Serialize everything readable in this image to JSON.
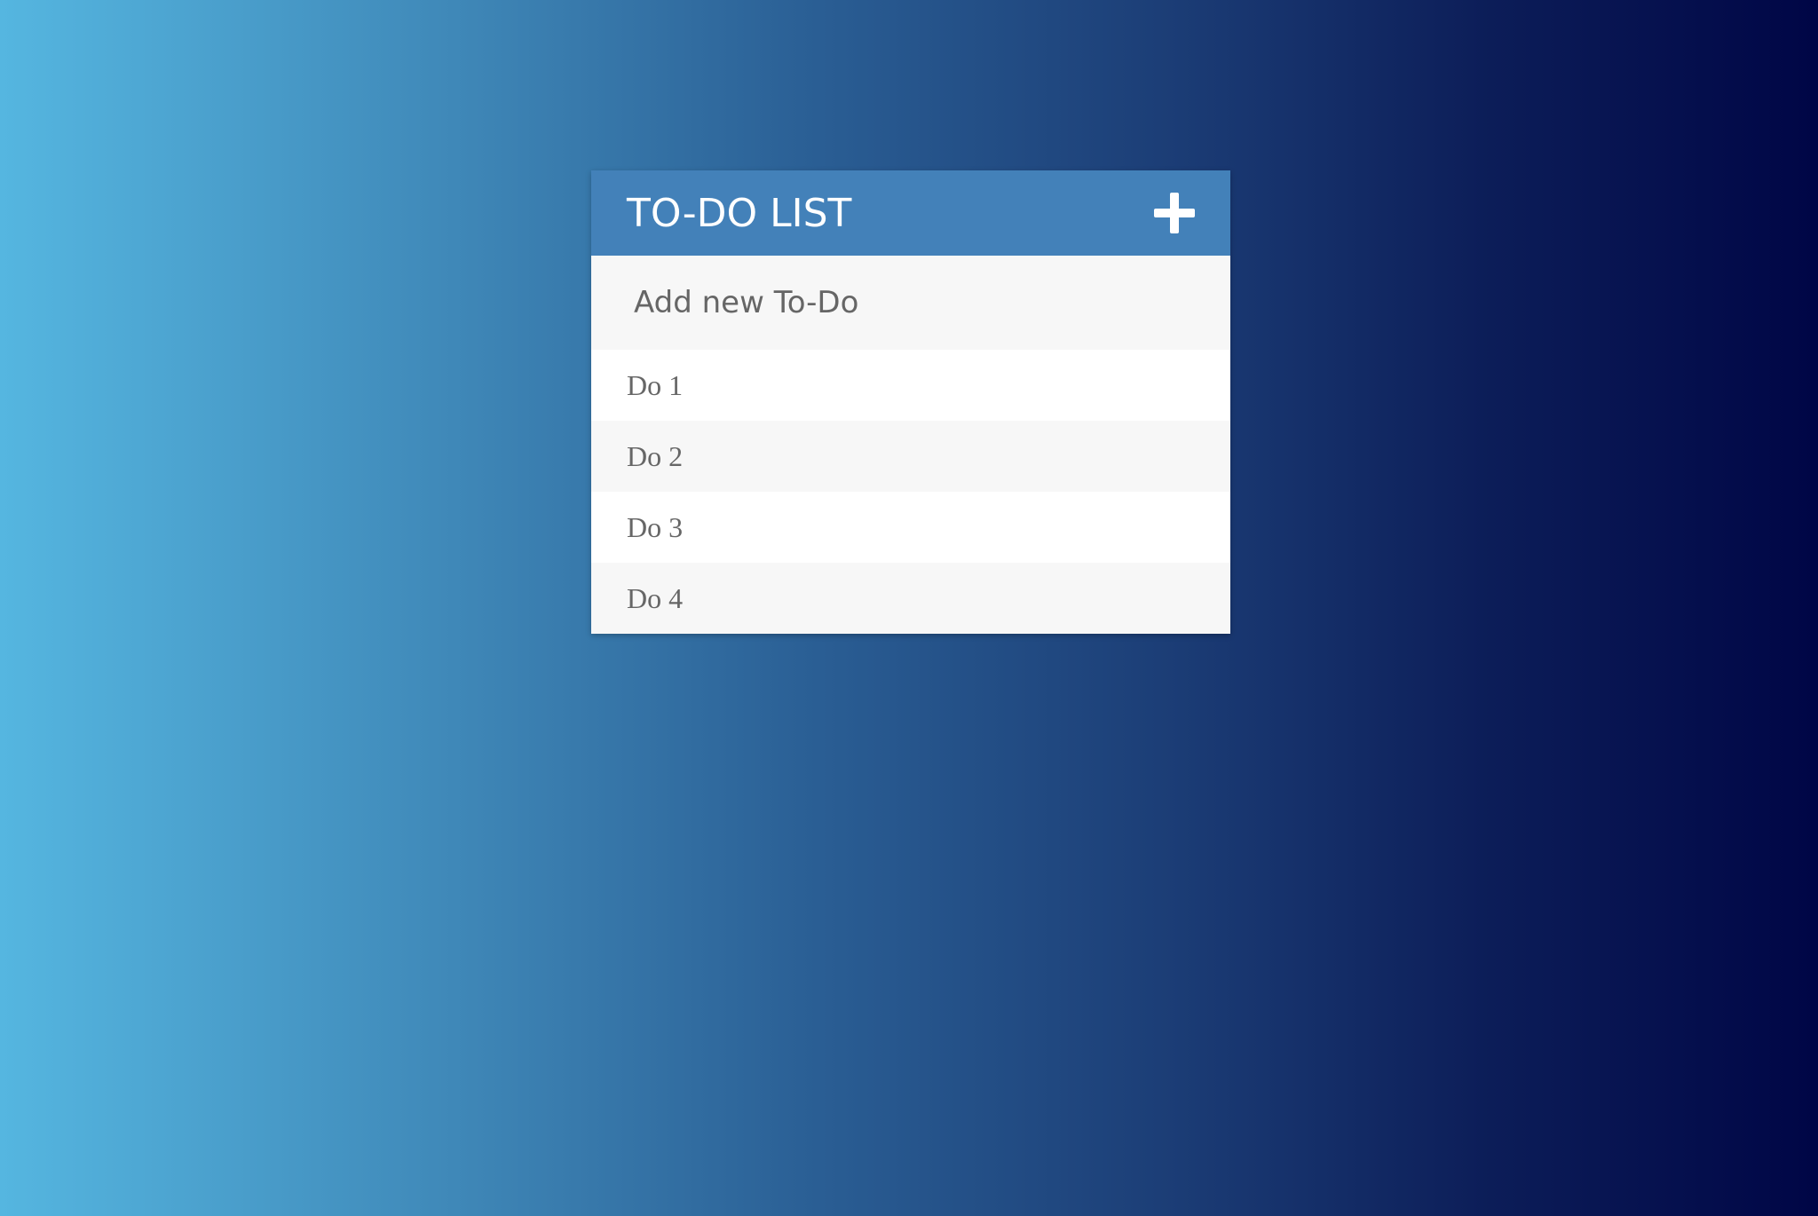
{
  "header": {
    "title": "TO-DO LIST",
    "add_icon": "plus-icon"
  },
  "new_todo": {
    "placeholder": "Add new To-Do",
    "value": ""
  },
  "todos": [
    {
      "label": "Do 1"
    },
    {
      "label": "Do 2"
    },
    {
      "label": "Do 3"
    },
    {
      "label": "Do 4"
    }
  ],
  "colors": {
    "header_bg": "#4381b9",
    "row_alt_bg": "#f7f7f7",
    "text": "#666666",
    "gradient_left": "#55b6e0",
    "gradient_right": "#000646"
  }
}
